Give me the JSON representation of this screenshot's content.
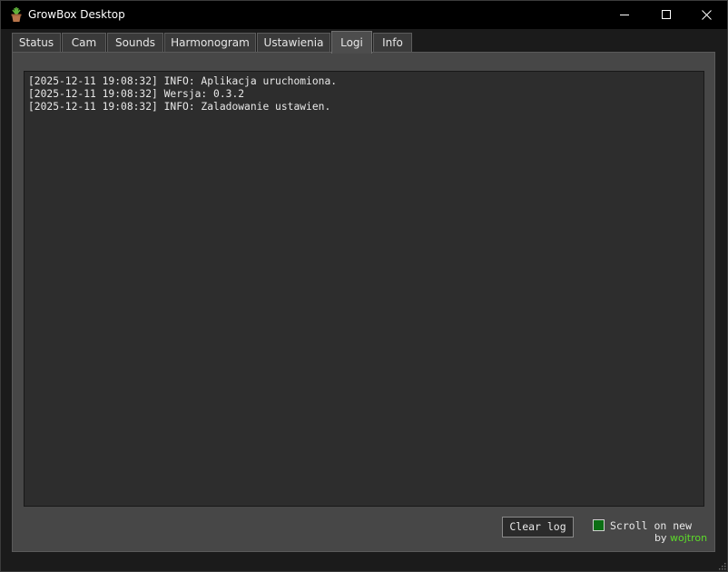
{
  "window": {
    "title": "GrowBox Desktop",
    "icon": "plant-pot-icon"
  },
  "tabs": [
    {
      "label": "Status",
      "active": false
    },
    {
      "label": "Cam",
      "active": false
    },
    {
      "label": "Sounds",
      "active": false
    },
    {
      "label": "Harmonogram",
      "active": false
    },
    {
      "label": "Ustawienia",
      "active": false
    },
    {
      "label": "Logi",
      "active": true
    },
    {
      "label": "Info",
      "active": false
    }
  ],
  "log": {
    "lines": [
      "[2025-12-11 19:08:32] INFO: Aplikacja uruchomiona.",
      "[2025-12-11 19:08:32] Wersja: 0.3.2",
      "[2025-12-11 19:08:32] INFO: Zaladowanie ustawien."
    ]
  },
  "controls": {
    "clear_label": "Clear log",
    "scroll_label": "Scroll on new",
    "scroll_checked": true
  },
  "credit": {
    "prefix": "by",
    "author": "wojtron"
  },
  "colors": {
    "accent_green": "#5ddc2a",
    "checkbox_fill": "#0b6e14"
  }
}
